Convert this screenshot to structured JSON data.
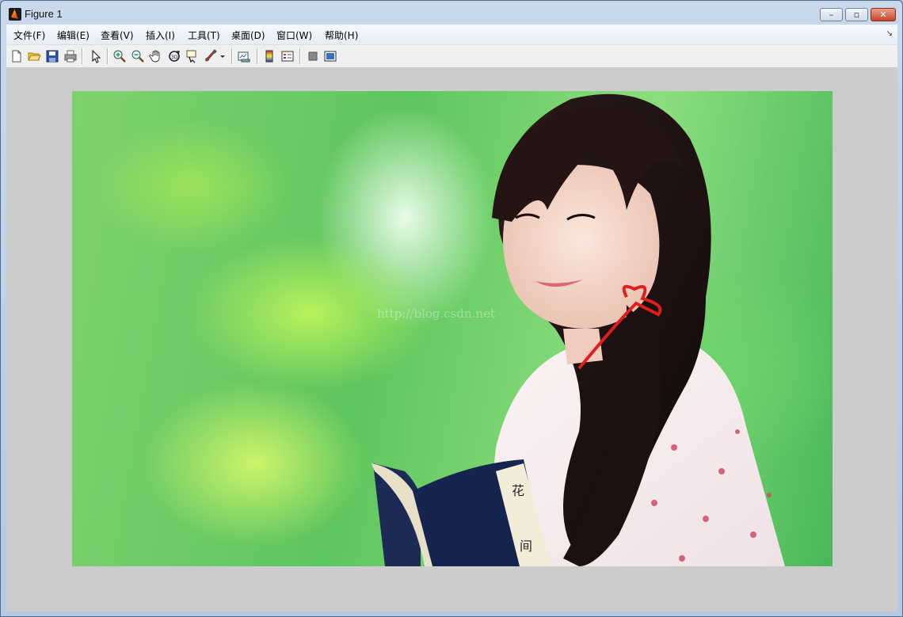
{
  "window": {
    "title": "Figure 1",
    "minimize_glyph": "–",
    "maximize_glyph": "▫",
    "close_glyph": "✕"
  },
  "menu": {
    "items": [
      {
        "label": "文件(F)"
      },
      {
        "label": "编辑(E)"
      },
      {
        "label": "查看(V)"
      },
      {
        "label": "插入(I)"
      },
      {
        "label": "工具(T)"
      },
      {
        "label": "桌面(D)"
      },
      {
        "label": "窗口(W)"
      },
      {
        "label": "帮助(H)"
      }
    ],
    "corner_glyph": "↘"
  },
  "toolbar": {
    "icons": [
      "new-figure-icon",
      "open-file-icon",
      "save-icon",
      "print-icon",
      "edit-plot-arrow-icon",
      "zoom-in-icon",
      "zoom-out-icon",
      "pan-hand-icon",
      "rotate-3d-icon",
      "data-cursor-icon",
      "brush-icon",
      "brush-dropdown-icon",
      "link-plot-icon",
      "colorbar-icon",
      "legend-icon",
      "hide-plot-tools-icon",
      "show-plot-tools-icon"
    ]
  },
  "figure": {
    "watermark": "http://blog.csdn.net",
    "book_text": "花 间"
  }
}
